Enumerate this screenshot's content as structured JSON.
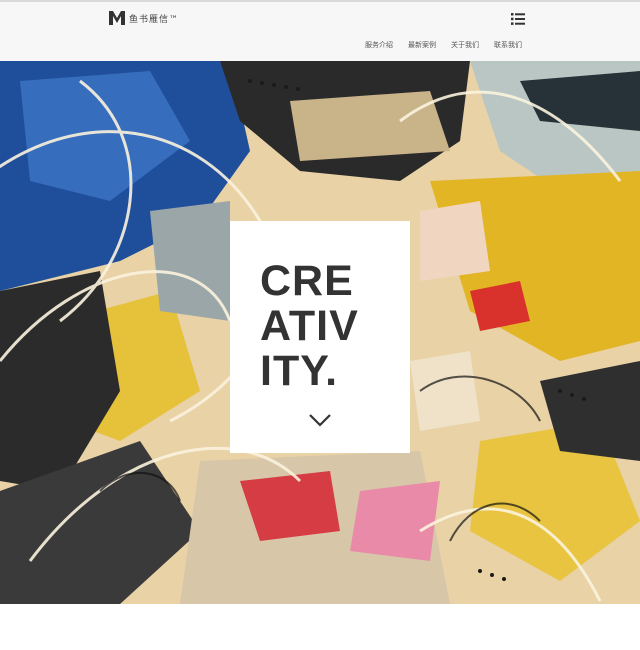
{
  "header": {
    "brand": "鱼书雁信™",
    "menu_icon": "list-icon"
  },
  "nav": {
    "items": [
      {
        "label": "服务介绍"
      },
      {
        "label": "最新案例"
      },
      {
        "label": "关于我们"
      },
      {
        "label": "联系我们"
      }
    ]
  },
  "hero": {
    "title_lines": [
      "CRE",
      "ATIV",
      "ITY."
    ],
    "scroll_icon": "chevron-down-icon"
  },
  "colors": {
    "header_bg": "#f7f7f7",
    "title": "#333333",
    "card_bg": "#ffffff"
  }
}
